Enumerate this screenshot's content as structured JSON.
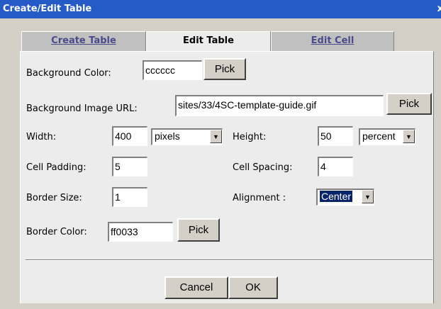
{
  "title_bar": {
    "title": "Create/Edit Table",
    "close": "x"
  },
  "tabs": [
    {
      "label": "Create Table"
    },
    {
      "label": "Edit Table"
    },
    {
      "label": "Edit Cell"
    }
  ],
  "form": {
    "bg_color_label": "Background Color:",
    "bg_color_value": "cccccc",
    "bg_image_label": "Background Image URL:",
    "bg_image_value": "sites/33/4SC-template-guide.gif",
    "pick_label": "Pick",
    "width_label": "Width:",
    "width_value": "400",
    "width_unit": "pixels",
    "height_label": "Height:",
    "height_value": "50",
    "height_unit": "percent",
    "cell_padding_label": "Cell Padding:",
    "cell_padding_value": "5",
    "cell_spacing_label": "Cell Spacing:",
    "cell_spacing_value": "4",
    "border_size_label": "Border Size:",
    "border_size_value": "1",
    "alignment_label": "Alignment :",
    "alignment_value": "Center",
    "border_color_label": "Border Color:",
    "border_color_value": "ff0033"
  },
  "footer": {
    "cancel_label": "Cancel",
    "ok_label": "OK"
  },
  "colors": {
    "titlebar": "#255bc6",
    "panel": "#ececec",
    "dialog": "#d4d0c8",
    "tab_link": "#4a4a8a"
  }
}
